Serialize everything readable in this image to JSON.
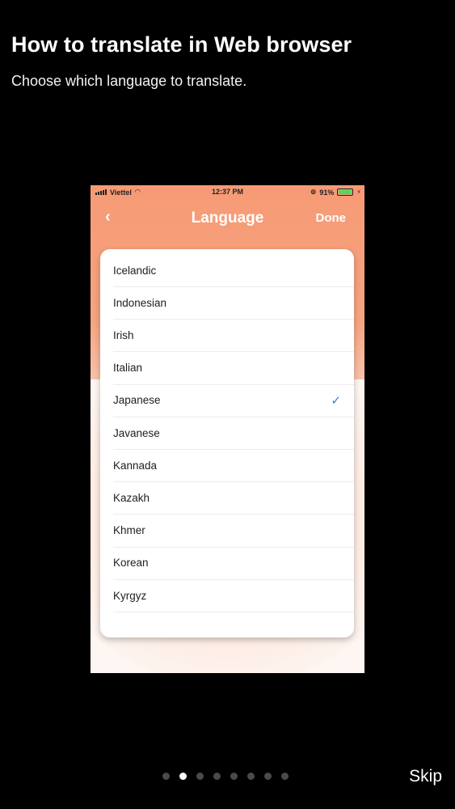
{
  "header": {
    "title": "How to translate in Web browser",
    "subtitle": "Choose which language to translate."
  },
  "phone": {
    "status_bar": {
      "carrier": "Viettel",
      "time": "12:37 PM",
      "battery": "91%"
    },
    "navbar": {
      "back_icon": "chevron-left-icon",
      "title": "Language",
      "done_label": "Done"
    },
    "languages": [
      {
        "label": "Icelandic",
        "selected": false
      },
      {
        "label": "Indonesian",
        "selected": false
      },
      {
        "label": "Irish",
        "selected": false
      },
      {
        "label": "Italian",
        "selected": false
      },
      {
        "label": "Japanese",
        "selected": true
      },
      {
        "label": "Javanese",
        "selected": false
      },
      {
        "label": "Kannada",
        "selected": false
      },
      {
        "label": "Kazakh",
        "selected": false
      },
      {
        "label": "Khmer",
        "selected": false
      },
      {
        "label": "Korean",
        "selected": false
      },
      {
        "label": "Kyrgyz",
        "selected": false
      }
    ],
    "colors": {
      "accent": "#f69a75",
      "check": "#2f80d9"
    }
  },
  "pager": {
    "total": 8,
    "current": 2
  },
  "footer": {
    "skip_label": "Skip"
  }
}
